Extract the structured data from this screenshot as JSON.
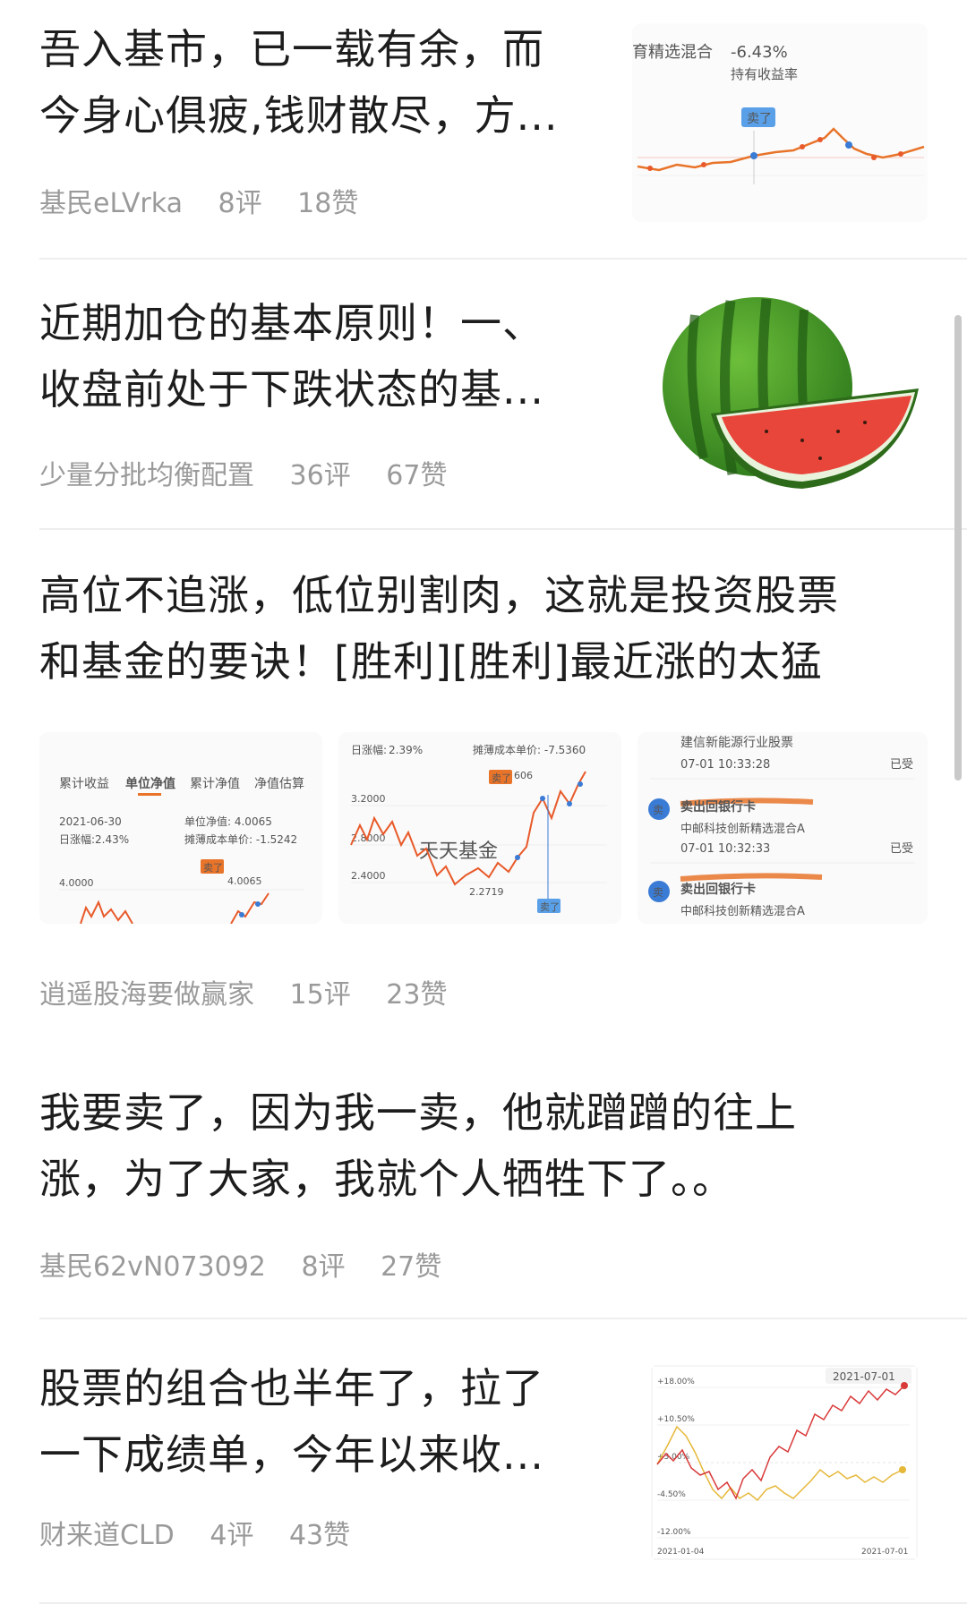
{
  "posts": [
    {
      "title_line1": "吾入基市，已一载有余，而",
      "title_line2": "今身心俱疲,钱财散尽，方...",
      "author": "基民eLVrka",
      "comments": "8评",
      "likes": "18赞",
      "thumb": {
        "fund_name": "育精选混合",
        "return_value": "-6.43%",
        "return_label": "持有收益率",
        "sell_tag": "卖了"
      }
    },
    {
      "title_line1": "近期加仓的基本原则！一、",
      "title_line2": "收盘前处于下跌状态的基...",
      "author": "少量分批均衡配置",
      "comments": "36评",
      "likes": "67赞",
      "thumb": {
        "icon": "watermelon-image"
      }
    },
    {
      "title_line1": "高位不追涨，低位别割肉，这就是投资股票",
      "title_line2": "和基金的要诀！[胜利][胜利]最近涨的太猛",
      "author": "逍遥股海要做赢家",
      "comments": "15评",
      "likes": "23赞",
      "images": {
        "img1": {
          "tabs": [
            "累计收益",
            "单位净值",
            "累计净值",
            "净值估算"
          ],
          "date": "2021-06-30",
          "nav_label": "单位净值: 4.0065",
          "change_label": "日涨幅:",
          "change_value": "2.43%",
          "cost_label": "摊薄成本单价: -1.5242",
          "y_tick": "4.0000",
          "point_label": "4.0065",
          "sell_tag": "卖了"
        },
        "img2": {
          "change_label": "日涨幅:",
          "change_value": "2.39%",
          "cost_label": "摊薄成本单价: -7.5360",
          "y_ticks": [
            "3.2000",
            "2.8000",
            "2.4000"
          ],
          "low_label": "2.2719",
          "high_label": "606",
          "sell_tag": "卖了",
          "sell_tag2": "卖了",
          "watermark": "天天基金"
        },
        "img3": {
          "top_fund": "建信新能源行业股票",
          "top_time": "07-01 10:33:28",
          "top_status": "已受",
          "badge": "卖",
          "items": [
            {
              "action": "卖出回银行卡",
              "fund": "中邮科技创新精选混合A",
              "time": "07-01 10:32:33",
              "status": "已受"
            },
            {
              "action": "卖出回银行卡",
              "fund": "中邮科技创新精选混合A"
            }
          ]
        }
      }
    },
    {
      "title_line1": "我要卖了，因为我一卖，他就蹭蹭的往上",
      "title_line2": "涨，为了大家，我就个人牺牲下了。。",
      "author": "基民62vN073092",
      "comments": "8评",
      "likes": "27赞"
    },
    {
      "title_line1": "股票的组合也半年了，拉了",
      "title_line2": "一下成绩单，今年以来收...",
      "author": "财来道CLD",
      "comments": "4评",
      "likes": "43赞",
      "thumb": {
        "date_top": "2021-07-01",
        "y_ticks": [
          "+18.00%",
          "+10.50%",
          "+3.00%",
          "-4.50%",
          "-12.00%"
        ],
        "x_start": "2021-01-04",
        "x_end": "2021-07-01"
      }
    }
  ],
  "colors": {
    "title": "#1d1d1d",
    "meta": "#9a9a9a",
    "up_red": "#e03c3c",
    "down_green": "#2aa34a",
    "orange_line": "#e8742a",
    "blue_marker": "#3a7bd5"
  }
}
